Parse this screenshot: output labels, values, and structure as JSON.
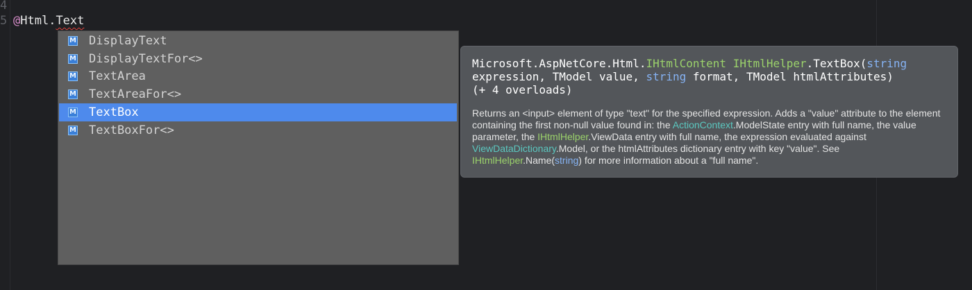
{
  "editor": {
    "line_numbers": [
      "4",
      "5"
    ],
    "code": {
      "at": "@",
      "prefix": "Html.",
      "typed": "Text"
    }
  },
  "completion": {
    "items": [
      {
        "icon": "M",
        "label": "DisplayText"
      },
      {
        "icon": "M",
        "label": "DisplayTextFor<>"
      },
      {
        "icon": "M",
        "label": "TextArea"
      },
      {
        "icon": "M",
        "label": "TextAreaFor<>"
      },
      {
        "icon": "M",
        "label": "TextBox"
      },
      {
        "icon": "M",
        "label": "TextBoxFor<>"
      }
    ],
    "selected_index": 4
  },
  "tooltip": {
    "signature": {
      "ns": "Microsoft.AspNetCore.Html.",
      "ret_type": "IHtmlContent",
      "owner": "IHtmlHelper",
      "method": ".TextBox(",
      "kw1": "string",
      "l2a": "expression, TModel value, ",
      "kw2": "string",
      "l2b": " format, TModel htmlAttributes)",
      "l3": "(+ 4 overloads)"
    },
    "description": {
      "t1": "Returns an <input> element of type \"text\" for the specified expression. Adds a \"value\" attribute to the element containing the first non-null value found in: the ",
      "c1": "ActionContext",
      "t2": ".ModelState entry with full name, the value parameter, the ",
      "i1": "IHtmlHelper",
      "t3": ".ViewData entry with full name, the expression evaluated against ",
      "c2": "ViewDataDictionary",
      "t4": ".Model, or the htmlAttributes dictionary entry with key \"value\". See ",
      "i2": "IHtmlHelper",
      "t5": ".Name(",
      "k1": "string",
      "t6": ") for more information about a \"full name\"."
    }
  },
  "colors": {
    "background": "#1f2023",
    "selection": "#4e8aec",
    "interface": "#9bd26b",
    "keyword": "#86b3f4",
    "class": "#5bc8c0"
  }
}
